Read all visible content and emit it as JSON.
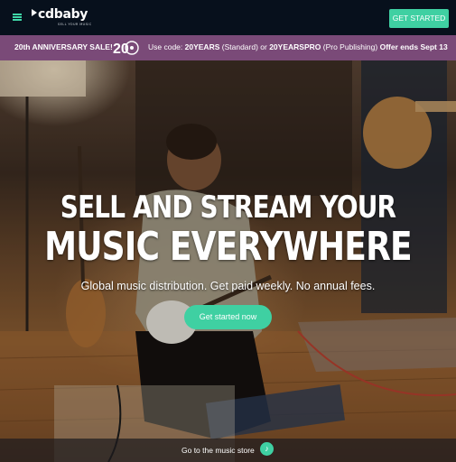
{
  "header": {
    "logo_text": "cdbaby",
    "logo_tagline": "SELL YOUR MUSIC",
    "menu_icon": "hamburger-icon",
    "cta_label": "GET STARTED",
    "accent_color": "#3fd0a2",
    "bg_color": "#07101c"
  },
  "promo": {
    "title": "20th ANNIVERSARY SALE!",
    "badge_text": "20",
    "code_prefix": "Use code: ",
    "code1": "20YEARS",
    "code1_note": " (Standard) or ",
    "code2": "20YEARSPRO",
    "code2_note": " (Pro Publishing) ",
    "offer_end": "Offer ends Sept 13",
    "bg_color": "#7a4a78"
  },
  "hero": {
    "headline_line1": "SELL AND STREAM YOUR",
    "headline_line2": "MUSIC EVERYWHERE",
    "subheadline": "Global music distribution. Get paid weekly. No annual fees.",
    "cta_label": "Get started now"
  },
  "footer_bar": {
    "label": "Go to the music store",
    "icon": "music-note-icon"
  }
}
